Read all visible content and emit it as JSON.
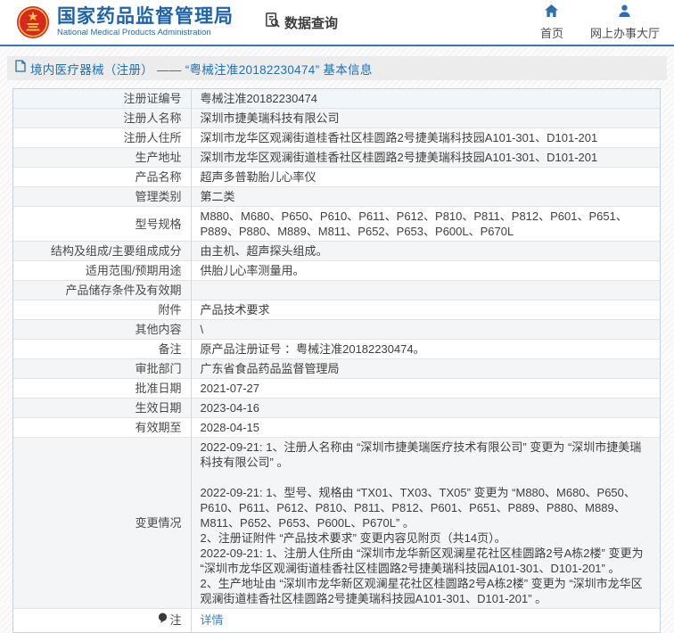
{
  "header": {
    "agency_name_cn": "国家药品监督管理局",
    "agency_name_en": "National Medical Products Administration",
    "nav_data_query": "数据查询",
    "nav_home": "首页",
    "nav_online_hall": "网上办事大厅"
  },
  "page_title": "境内医疗器械（注册） —— “粤械注准20182230474” 基本信息",
  "table": {
    "rows": [
      {
        "label": "注册证编号",
        "value": "粤械注准20182230474"
      },
      {
        "label": "注册人名称",
        "value": "深圳市捷美瑞科技有限公司"
      },
      {
        "label": "注册人住所",
        "value": "深圳市龙华区观澜街道桂香社区桂圆路2号捷美瑞科技园A101-301、D101-201"
      },
      {
        "label": "生产地址",
        "value": "深圳市龙华区观澜街道桂香社区桂圆路2号捷美瑞科技园A101-301、D101-201"
      },
      {
        "label": "产品名称",
        "value": "超声多普勒胎儿心率仪"
      },
      {
        "label": "管理类别",
        "value": "第二类"
      },
      {
        "label": "型号规格",
        "value": "M880、M680、P650、P610、P611、P612、P810、P811、P812、P601、P651、P889、P880、M889、M811、P652、P653、P600L、P670L"
      },
      {
        "label": "结构及组成/主要组成成分",
        "value": "由主机、超声探头组成。"
      },
      {
        "label": "适用范围/预期用途",
        "value": "供胎儿心率测量用。"
      },
      {
        "label": "产品储存条件及有效期",
        "value": ""
      },
      {
        "label": "附件",
        "value": "产品技术要求"
      },
      {
        "label": "其他内容",
        "value": "\\"
      },
      {
        "label": "备注",
        "value": "原产品注册证号 ：粤械注准20182230474。"
      },
      {
        "label": "审批部门",
        "value": "广东省食品药品监督管理局"
      },
      {
        "label": "批准日期",
        "value": "2021-07-27"
      },
      {
        "label": "生效日期",
        "value": "2023-04-16"
      },
      {
        "label": "有效期至",
        "value": "2028-04-15"
      },
      {
        "label": "变更情况",
        "value": [
          "2022-09-21: 1、注册人名称由 “深圳市捷美瑞医疗技术有限公司” 变更为 “深圳市捷美瑞科技有限公司” 。",
          "",
          "2022-09-21: 1、型号、规格由 “TX01、TX03、TX05” 变更为 “M880、M680、P650、P610、P611、P612、P810、P811、P812、P601、P651、P889、P880、M889、M811、P652、P653、P600L、P670L” 。",
          "2、注册证附件 “产品技术要求” 变更内容见附页（共14页）。",
          "2022-09-21: 1、注册人住所由 “深圳市龙华新区观澜星花社区桂圆路2号A栋2楼” 变更为 “深圳市龙华区观澜街道桂香社区桂圆路2号捷美瑞科技园A101-301、D101-201” 。",
          "2、生产地址由 “深圳市龙华新区观澜星花社区桂圆路2号A栋2楼” 变更为 “深圳市龙华区观澜街道桂香社区桂圆路2号捷美瑞科技园A101-301、D101-201” 。"
        ]
      }
    ]
  },
  "note_row": {
    "label": "注",
    "link_label": "详情"
  },
  "colors": {
    "accent_blue": "#1d63ae",
    "header_border": "#2d7ab8",
    "link_blue": "#3c86cd",
    "emblem_red": "#d7281f",
    "emblem_gold": "#f5c945"
  }
}
